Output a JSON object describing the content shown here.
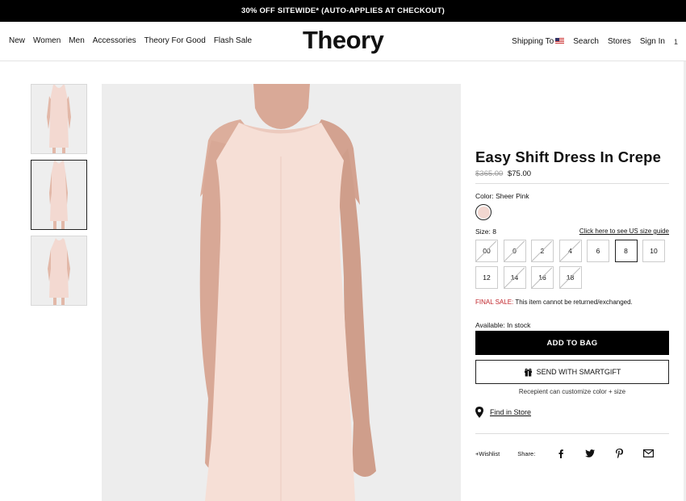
{
  "promo": {
    "text": "30% OFF SITEWIDE* (AUTO-APPLIES AT CHECKOUT)"
  },
  "header": {
    "logo": "Theory",
    "nav_left": [
      "New",
      "Women",
      "Men",
      "Accessories",
      "Theory For Good",
      "Flash Sale"
    ],
    "shipping": "Shipping To",
    "search": "Search",
    "stores": "Stores",
    "sign_in": "Sign In",
    "bag_count": "1"
  },
  "product": {
    "title": "Easy Shift Dress In Crepe",
    "old_price": "$365.00",
    "price": "$75.00",
    "color_label": "Color:",
    "color_value": "Sheer Pink",
    "color_hex": "#f2d7d0",
    "size_label": "Size:",
    "size_value": "8",
    "size_guide": "Click here to see US size guide",
    "sizes": [
      {
        "label": "00",
        "available": false
      },
      {
        "label": "0",
        "available": false
      },
      {
        "label": "2",
        "available": false
      },
      {
        "label": "4",
        "available": false
      },
      {
        "label": "6",
        "available": true
      },
      {
        "label": "8",
        "available": true,
        "selected": true
      },
      {
        "label": "10",
        "available": true
      },
      {
        "label": "12",
        "available": true
      },
      {
        "label": "14",
        "available": false
      },
      {
        "label": "16",
        "available": false
      },
      {
        "label": "18",
        "available": false
      }
    ],
    "final_sale_label": "FINAL SALE:",
    "final_sale_text": "This item cannot be returned/exchanged.",
    "availability": "Available: In stock",
    "add_to_bag": "ADD TO BAG",
    "smartgift": "SEND WITH SMARTGIFT",
    "recipient_note": "Recepient can customize color + size",
    "find_in_store": "Find in Store",
    "wishlist": "+Wishlist",
    "share": "Share:"
  }
}
